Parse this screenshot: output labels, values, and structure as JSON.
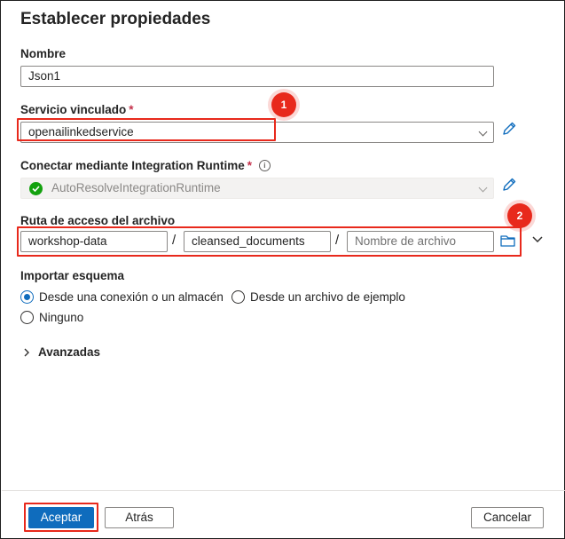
{
  "dialog": {
    "title": "Establecer propiedades"
  },
  "name": {
    "label": "Nombre",
    "value": "Json1"
  },
  "linked_service": {
    "label": "Servicio vinculado",
    "required": "*",
    "value": "openailinkedservice"
  },
  "integration_runtime": {
    "label": "Conectar mediante Integration Runtime",
    "required": "*",
    "info_icon": "info-icon",
    "value": "AutoResolveIntegrationRuntime",
    "status_color": "#13a10e"
  },
  "file_path": {
    "label": "Ruta de acceso del archivo",
    "container": "workshop-data",
    "directory": "cleansed_documents",
    "separator": "/",
    "file_placeholder": "Nombre de archivo"
  },
  "schema": {
    "label": "Importar esquema",
    "options": [
      "Desde una conexión o un almacén",
      "Desde un archivo de ejemplo",
      "Ninguno"
    ],
    "selected": "Desde una conexión o un almacén"
  },
  "advanced": {
    "label": "Avanzadas"
  },
  "annotations": {
    "badge1": "1",
    "badge2": "2",
    "highlight_color": "#e8291c"
  },
  "footer": {
    "accept": "Aceptar",
    "back": "Atrás",
    "cancel": "Cancelar"
  },
  "colors": {
    "accent": "#0f6cbd",
    "edit_icon": "#0f6cbd"
  }
}
